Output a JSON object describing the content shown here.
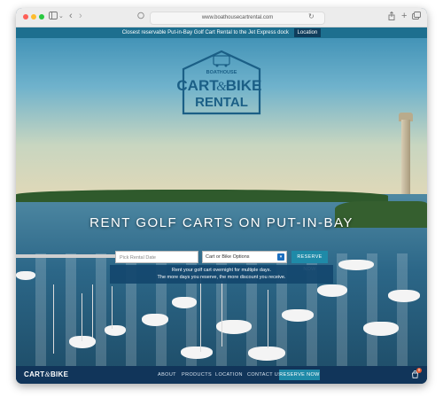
{
  "browser": {
    "url": "www.boathousecartrental.com"
  },
  "announcement": {
    "text": "Closest reservable Put-in-Bay Golf Cart Rental to the Jet Express dock",
    "button": "Location"
  },
  "logo": {
    "top": "BOATHOUSE",
    "line1a": "CART",
    "amp": "&",
    "line1b": "BIKE",
    "line2": "RENTAL"
  },
  "hero": {
    "headline": "RENT GOLF CARTS ON PUT-IN-BAY"
  },
  "form": {
    "date_placeholder": "Pick Rental Date",
    "options_value": "Cart or Bike Options",
    "reserve_label": "RESERVE NOW",
    "note_line1": "Rent your golf cart overnight for multiple days.",
    "note_line2": "The more days you reserve, the more discount you receive."
  },
  "footer": {
    "logo_a": "CART",
    "logo_amp": "&",
    "logo_b": "BIKE",
    "nav": [
      "ABOUT",
      "PRODUCTS",
      "LOCATION",
      "CONTACT US"
    ],
    "reserve_label": "RESERVE NOW",
    "cart_count": "0"
  },
  "colors": {
    "brand_blue": "#11355a",
    "accent_teal": "#1f8aa8",
    "announce_bar": "#1d6f8f",
    "cart_badge": "#e4572e"
  },
  "icons": [
    "sidebar-icon",
    "back-icon",
    "forward-icon",
    "privacy-icon",
    "reload-icon",
    "share-icon",
    "new-tab-icon",
    "tabs-icon",
    "cart-icon",
    "chevron-down-icon"
  ]
}
